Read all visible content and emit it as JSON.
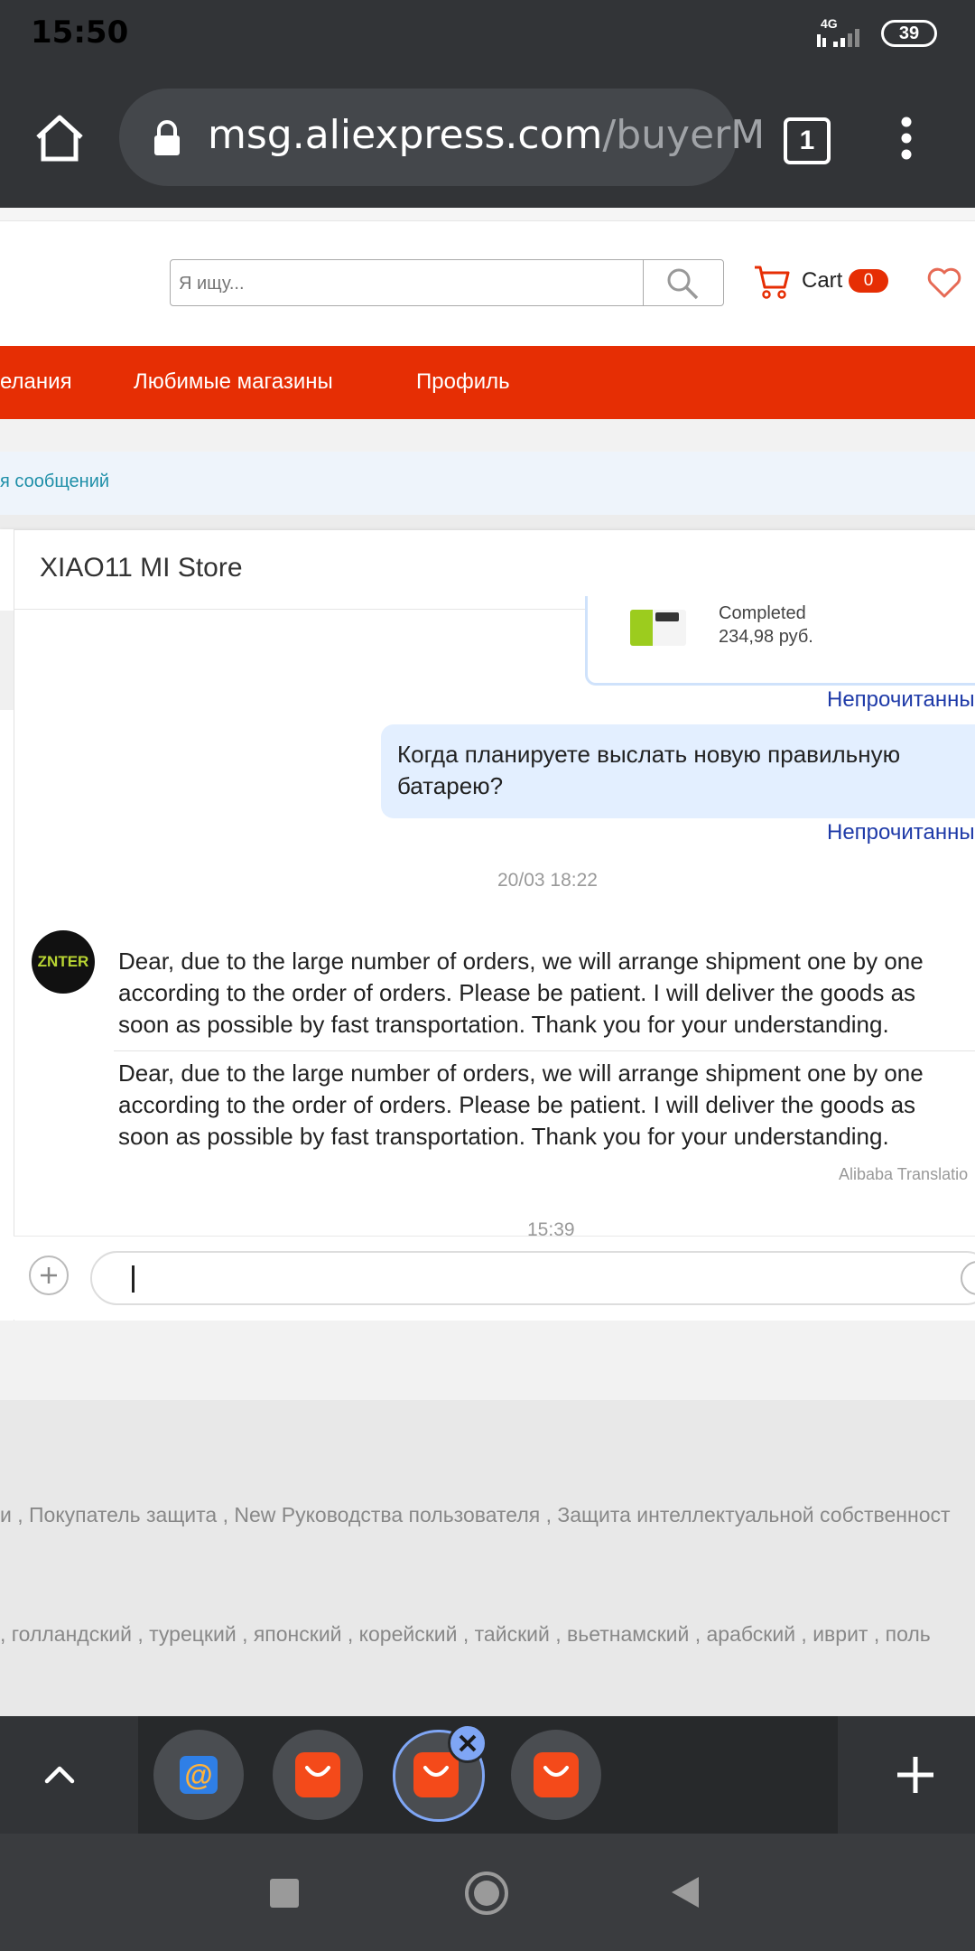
{
  "status_bar": {
    "time": "15:50",
    "network": "4G",
    "battery": "39"
  },
  "browser": {
    "url_domain": "msg.aliexpress.com",
    "url_path": "/buyerM",
    "tab_count": "1"
  },
  "header": {
    "search_placeholder": "Я ищу...",
    "cart_label": "Cart",
    "cart_count": "0"
  },
  "nav": {
    "items": [
      "елания",
      "Любимые магазины",
      "Профиль"
    ]
  },
  "messages_breadcrumb": "я сообщений",
  "chat": {
    "store_name": "XIAO11 MI Store",
    "order_card": {
      "status": "Completed",
      "price": "234,98 руб."
    },
    "unread_label_1": "Непрочитанны",
    "buyer_message": "Когда планируете выслать новую правильную батарею?",
    "unread_label_2": "Непрочитанны",
    "timestamp_1": "20/03 18:22",
    "seller_avatar_text": "ZNTER",
    "seller_message": "Dear, due to the large number of orders, we will arrange shipment one by one according to the order of orders. Please be patient. I will deliver the goods as soon as possible by fast transportation. Thank you for your understanding.",
    "seller_translation": "Dear, due to the large number of orders, we will arrange shipment one by one according to the order of orders. Please be patient. I will deliver the goods as soon as possible by fast transportation. Thank you for your understanding.",
    "translation_credit": "Alibaba Translatio",
    "timestamp_2": "15:39",
    "input_value": ""
  },
  "footer": {
    "links_line": "и , Покупатель защита , New Руководства пользователя , Защита интеллектуальной собственност",
    "languages_line": ", голландский , турецкий , японский , корейский , тайский , вьетнамский , арабский , иврит , поль"
  },
  "colors": {
    "brand_red": "#e62e04",
    "chrome_dark": "#323437",
    "link_blue": "#1e3aa8",
    "bubble_blue": "#e3efff",
    "tab_highlight": "#7fa6f5"
  }
}
